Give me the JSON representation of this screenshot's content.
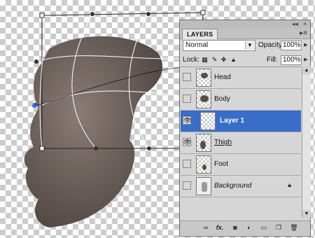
{
  "panel": {
    "tab": "LAYERS",
    "controls": {
      "collapse": "◂◂",
      "close": "×"
    },
    "menu_icon": "panel-menu-icon",
    "blend_mode": "Normal",
    "opacity_label": "Opacity:",
    "opacity_value": "100%",
    "lock_label": "Lock:",
    "fill_label": "Fill:",
    "fill_value": "100%"
  },
  "layers": [
    {
      "name": "Head",
      "visible": false,
      "selected": false,
      "italic": false,
      "locked": false
    },
    {
      "name": "Body",
      "visible": false,
      "selected": false,
      "italic": false,
      "locked": false
    },
    {
      "name": "Layer 1",
      "visible": true,
      "selected": true,
      "italic": false,
      "locked": false
    },
    {
      "name": "Thigh",
      "visible": true,
      "selected": false,
      "italic": false,
      "locked": false
    },
    {
      "name": "Foot",
      "visible": false,
      "selected": false,
      "italic": false,
      "locked": false
    },
    {
      "name": "Background",
      "visible": false,
      "selected": false,
      "italic": true,
      "locked": true
    }
  ],
  "bottom_icons": [
    "link-layers-icon",
    "layer-style-fx-icon",
    "layer-mask-icon",
    "adjustment-layer-icon",
    "group-folder-icon",
    "new-layer-icon",
    "delete-layer-icon"
  ],
  "bottom_glyphs": {
    "fx": "fx."
  },
  "colors": {
    "selection": "#3a6cc9",
    "panel_bg": "#d6d6d6",
    "skin": "#6e605a"
  }
}
